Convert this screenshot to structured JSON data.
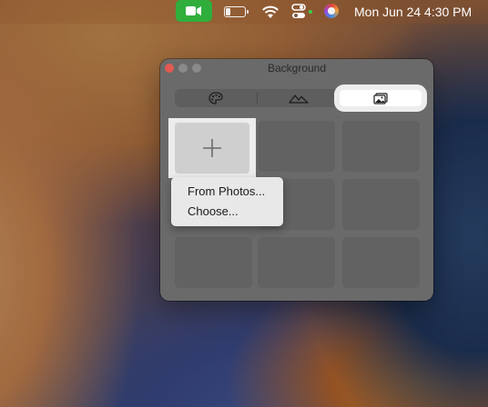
{
  "menubar": {
    "clock": "Mon Jun 24  4:30 PM",
    "icons": [
      "facetime-icon",
      "battery-icon",
      "wifi-icon",
      "control-center-icon",
      "siri-icon"
    ],
    "accent": "#2fae3c"
  },
  "window": {
    "title": "Background",
    "tabs": [
      {
        "icon": "palette-icon",
        "active": false
      },
      {
        "icon": "mountains-icon",
        "active": false
      },
      {
        "icon": "photo-icon",
        "active": true
      }
    ]
  },
  "context_menu": {
    "items": [
      "From Photos...",
      "Choose..."
    ]
  }
}
